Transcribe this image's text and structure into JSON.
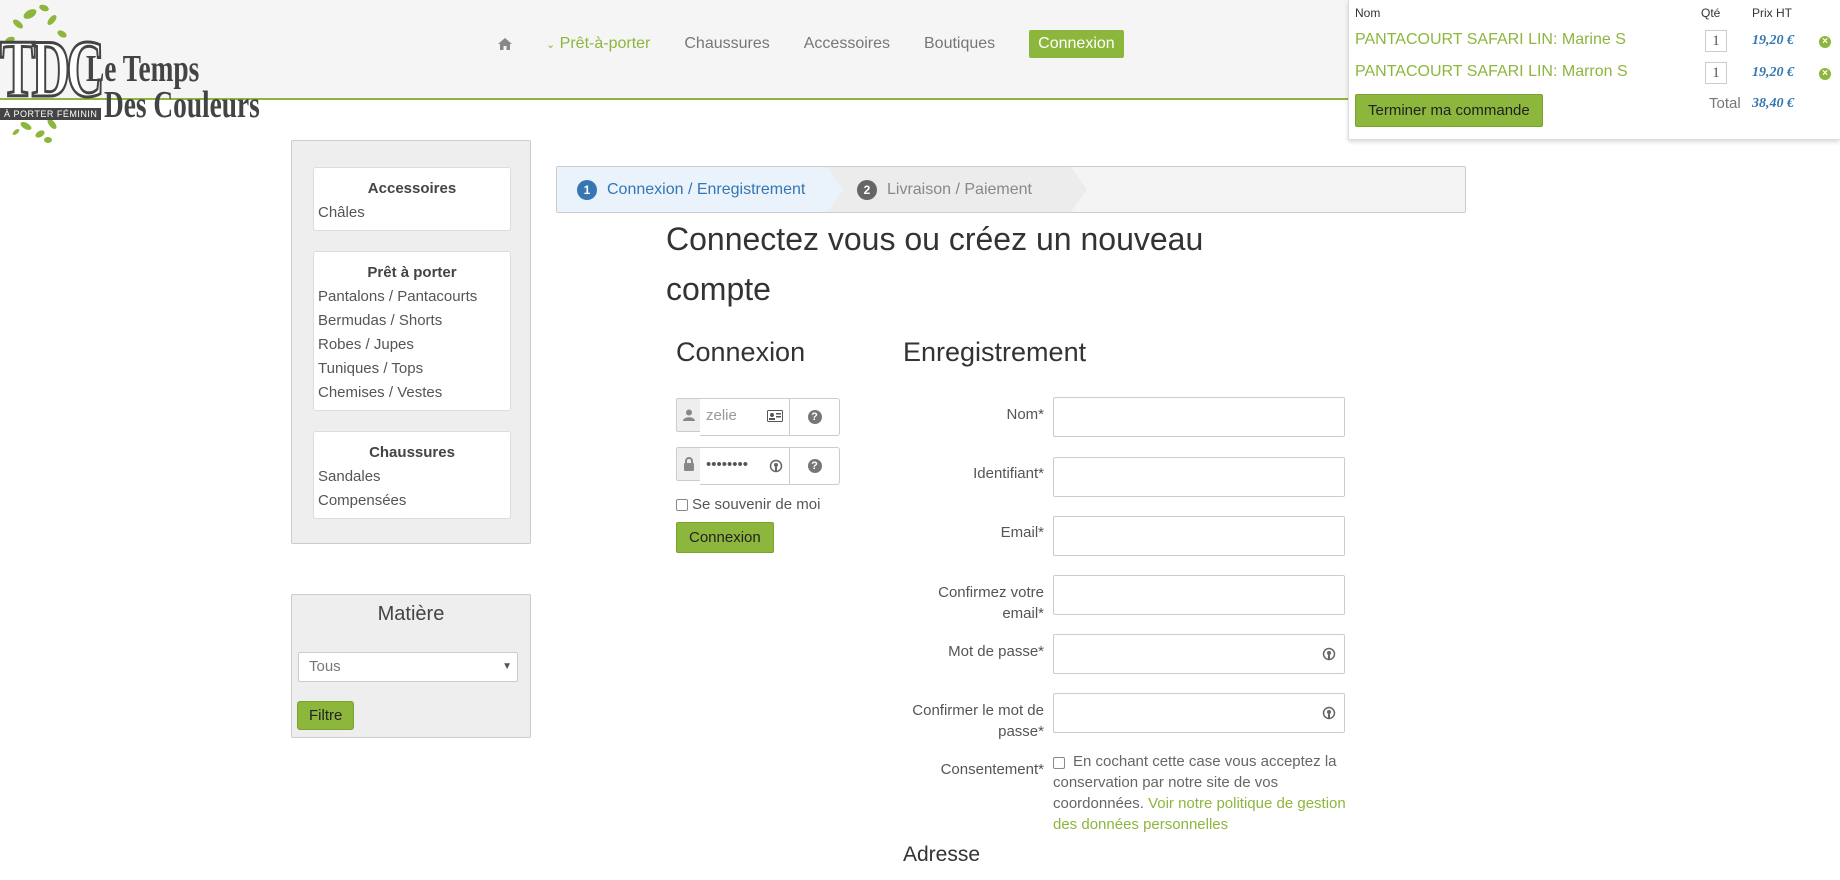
{
  "logo": {
    "monogram": "TDC",
    "title_line1": "Le Temps",
    "title_line2": "Des Couleurs",
    "tagline": "À PORTER FÉMININ"
  },
  "nav": {
    "home_icon": "home-icon",
    "items": [
      "Prêt-à-porter",
      "Chaussures",
      "Accessoires",
      "Boutiques"
    ],
    "login": "Connexion"
  },
  "cart": {
    "headers": {
      "name": "Nom",
      "qty": "Qté",
      "price": "Prix HT"
    },
    "items": [
      {
        "name": "PANTACOURT SAFARI LIN: Marine S",
        "qty": "1",
        "price": "19,20 €"
      },
      {
        "name": "PANTACOURT SAFARI LIN: Marron S",
        "qty": "1",
        "price": "19,20 €"
      }
    ],
    "finish_button": "Terminer ma commande",
    "total_label": "Total",
    "total_value": "38,40 €"
  },
  "sidebar": {
    "categories": [
      {
        "title": "Accessoires",
        "items": [
          "Châles"
        ]
      },
      {
        "title": "Prêt à porter",
        "items": [
          "Pantalons / Pantacourts",
          "Bermudas / Shorts",
          "Robes / Jupes",
          "Tuniques / Tops",
          "Chemises / Vestes"
        ]
      },
      {
        "title": "Chaussures",
        "items": [
          "Sandales",
          "Compensées"
        ]
      }
    ],
    "filter": {
      "title": "Matière",
      "selected": "Tous",
      "button": "Filtre"
    }
  },
  "steps": [
    {
      "num": "1",
      "label": "Connexion / Enregistrement"
    },
    {
      "num": "2",
      "label": "Livraison / Paiement"
    }
  ],
  "page_title": "Connectez vous ou créez un nouveau compte",
  "login": {
    "title": "Connexion",
    "username": "zelie",
    "password": "••••••••",
    "remember": "Se souvenir de moi",
    "submit": "Connexion"
  },
  "register": {
    "title": "Enregistrement",
    "labels": {
      "nom": "Nom*",
      "identifiant": "Identifiant*",
      "email": "Email*",
      "confirm_email": "Confirmez votre email*",
      "password": "Mot de passe*",
      "confirm_password": "Confirmer le mot de passe*",
      "consent": "Consentement*"
    },
    "consent_text": "En cochant cette case vous acceptez la conservation par notre site de vos coordonnées.",
    "consent_link": "Voir notre politique de gestion des données personnelles",
    "address_title": "Adresse"
  },
  "colors": {
    "accent": "#8db63d",
    "link_blue": "#3576b3"
  }
}
